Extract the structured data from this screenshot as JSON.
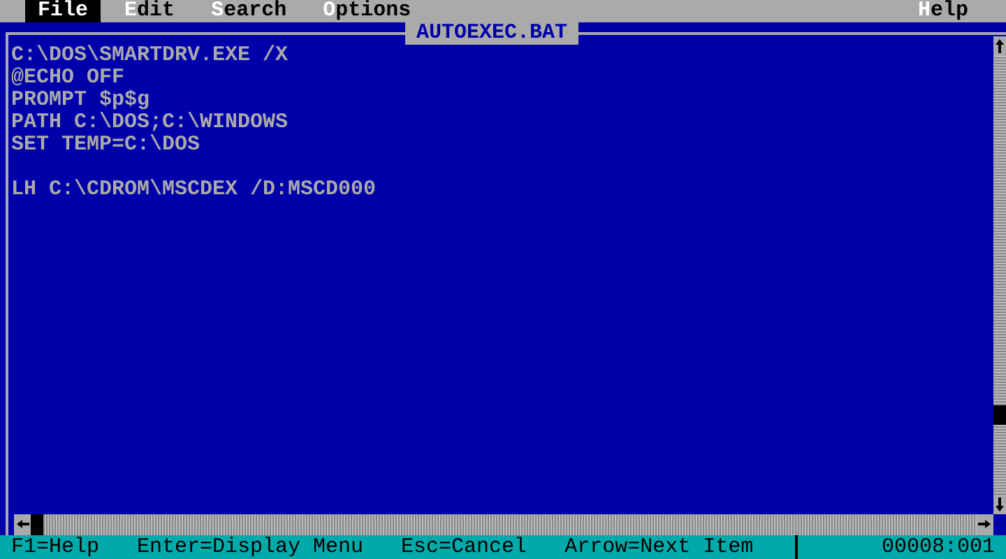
{
  "menu_bar": {
    "items": [
      {
        "label": "File",
        "selected": true
      },
      {
        "label": "Edit",
        "selected": false
      },
      {
        "label": "Search",
        "selected": false
      },
      {
        "label": "Options",
        "selected": false
      }
    ],
    "help": "Help"
  },
  "editor": {
    "title": "AUTOEXEC.BAT",
    "lines": [
      {
        "kind": "text",
        "text": "C:\\DOS\\SMARTDRV.EXE /X"
      },
      {
        "kind": "text",
        "text": "@ECHO OFF"
      },
      {
        "kind": "text",
        "text": "PROMPT $p$g"
      },
      {
        "kind": "text",
        "text": "PATH C:\\DOS;C:\\WINDOWS"
      },
      {
        "kind": "text",
        "text": "SET TEMP=C:\\DOS"
      },
      {
        "kind": "blank"
      },
      {
        "kind": "text",
        "text": "LH C:\\CDROM\\MSCDEX /D:MSCD000"
      }
    ]
  },
  "status_bar": {
    "hints": [
      "F1=Help",
      "Enter=Display Menu",
      "Esc=Cancel",
      "Arrow=Next Item"
    ],
    "position": "00008:001"
  }
}
